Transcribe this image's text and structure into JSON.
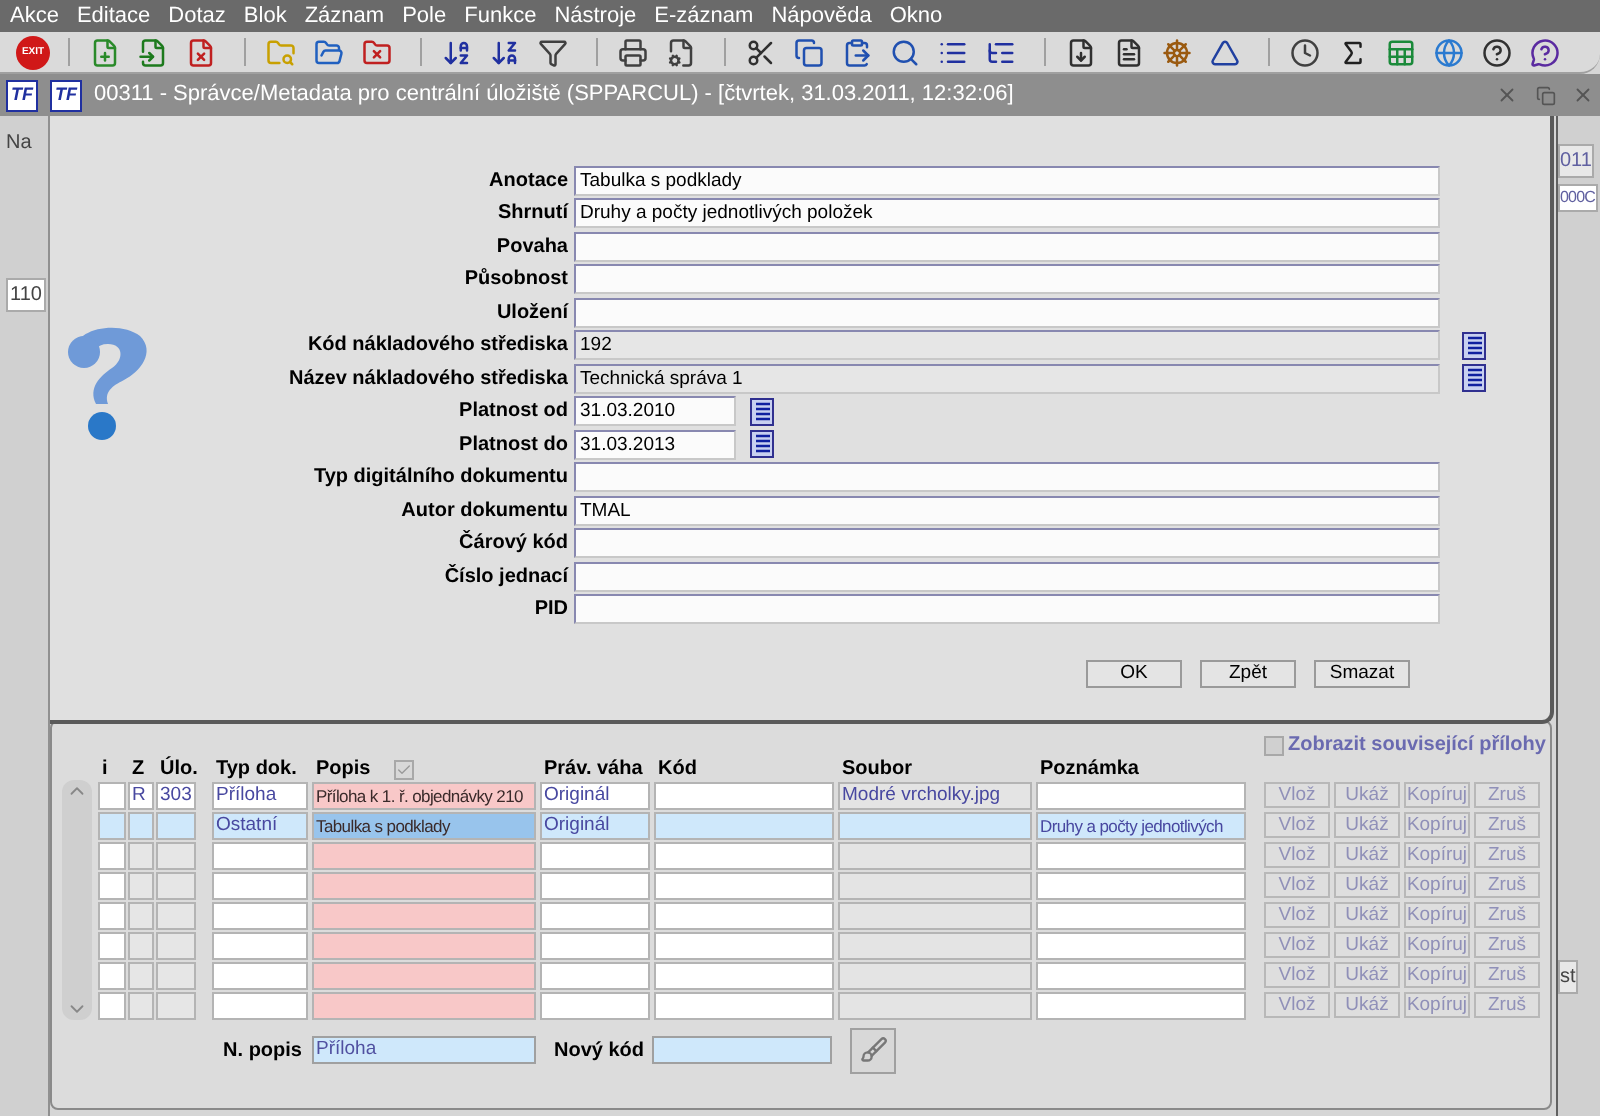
{
  "menu": [
    "Akce",
    "Editace",
    "Dotaz",
    "Blok",
    "Záznam",
    "Pole",
    "Funkce",
    "Nástroje",
    "E-záznam",
    "Nápověda",
    "Okno"
  ],
  "toolbar": {
    "exit_label": "EXIT"
  },
  "window": {
    "logos": [
      "TF",
      "TF"
    ],
    "title": "00311 - Správce/Metadata pro centrální úložiště (SPPARCUL) - [čtvrtek, 31.03.2011, 12:32:06]"
  },
  "background": {
    "left_texts": [
      "Na",
      "110"
    ],
    "right_texts": [
      "011",
      "000C",
      "st"
    ]
  },
  "dialog": {
    "fields": [
      {
        "label": "Anotace",
        "value": "Tabulka s podklady",
        "kind": "text"
      },
      {
        "label": "Shrnutí",
        "value": "Druhy a počty jednotlivých položek",
        "kind": "text"
      },
      {
        "label": "Povaha",
        "kind": "text"
      },
      {
        "label": "Působnost",
        "kind": "text"
      },
      {
        "label": "Uložení",
        "kind": "text"
      },
      {
        "label": "Kód nákladového střediska",
        "value": "192",
        "kind": "lookup"
      },
      {
        "label": "Název nákladového střediska",
        "value": "Technická správa 1",
        "kind": "lookup"
      },
      {
        "label": "Platnost od",
        "value": "31.03.2010",
        "kind": "date"
      },
      {
        "label": "Platnost do",
        "value": "31.03.2013",
        "kind": "date"
      },
      {
        "label": "Typ digitálního dokumentu",
        "kind": "text"
      },
      {
        "label": "Autor dokumentu",
        "value": "TMAL",
        "kind": "text"
      },
      {
        "label": "Čárový kód",
        "kind": "text"
      },
      {
        "label": "Číslo jednací",
        "kind": "text"
      },
      {
        "label": "PID",
        "kind": "text"
      }
    ],
    "buttons": [
      "OK",
      "Zpět",
      "Smazat"
    ]
  },
  "attachments": {
    "show_related": {
      "label": "Zobrazit související přílohy",
      "checked": false
    },
    "columns": [
      "i",
      "Z",
      "Úlo.",
      "Typ dok.",
      "Popis",
      "Práv. váha",
      "Kód",
      "Soubor",
      "Poznámka"
    ],
    "popis_check": {
      "checked": true
    },
    "rows": [
      {
        "selected": false,
        "z": "R",
        "ulo": "303",
        "typ": "Příloha",
        "popis": "Příloha k 1. ř. objednávky 210",
        "prav": "Originál",
        "soubor": "Modré vrcholky.jpg",
        "buttons": [
          "Vlož",
          "Ukáž",
          "Kopíruj",
          "Zruš"
        ]
      },
      {
        "selected": true,
        "typ": "Ostatní",
        "popis": "Tabulka s podklady",
        "prav": "Originál",
        "poznamka": "Druhy a počty jednotlivých",
        "buttons": [
          "Vlož",
          "Ukáž",
          "Kopíruj",
          "Zruš"
        ]
      },
      {
        "selected": false,
        "buttons": [
          "Vlož",
          "Ukáž",
          "Kopíruj",
          "Zruš"
        ]
      },
      {
        "selected": false,
        "buttons": [
          "Vlož",
          "Ukáž",
          "Kopíruj",
          "Zruš"
        ]
      },
      {
        "selected": false,
        "buttons": [
          "Vlož",
          "Ukáž",
          "Kopíruj",
          "Zruš"
        ]
      },
      {
        "selected": false,
        "buttons": [
          "Vlož",
          "Ukáž",
          "Kopíruj",
          "Zruš"
        ]
      },
      {
        "selected": false,
        "buttons": [
          "Vlož",
          "Ukáž",
          "Kopíruj",
          "Zruš"
        ]
      },
      {
        "selected": false,
        "buttons": [
          "Vlož",
          "Ukáž",
          "Kopíruj",
          "Zruš"
        ]
      }
    ],
    "footer": {
      "n_popis_label": "N. popis",
      "n_popis_value": "Příloha",
      "novy_kod_label": "Nový kód"
    }
  }
}
